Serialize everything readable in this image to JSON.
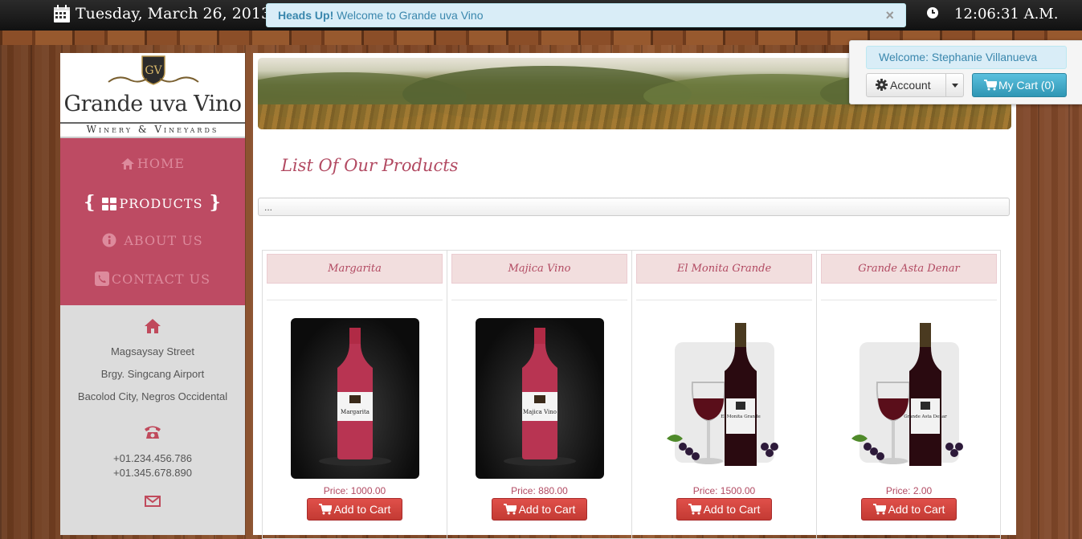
{
  "topbar": {
    "date": "Tuesday, March 26, 2013",
    "time": "12:06:31 A.M.",
    "alert_strong": "Heads Up!",
    "alert_text": "Welcome to Grande uva Vino",
    "alert_close": "×"
  },
  "account": {
    "welcome": "Welcome: Stephanie Villanueva",
    "account_label": "Account",
    "cart_label": "My Cart (0)"
  },
  "brand": {
    "name": "Grande uva Vino",
    "tagline": "Winery & Vineyards",
    "monogram": "GV"
  },
  "nav": {
    "items": [
      {
        "label": "HOME",
        "icon": "home-icon"
      },
      {
        "label": "PRODUCTS",
        "icon": "grid-icon",
        "active": true
      },
      {
        "label": "ABOUT US",
        "icon": "info-icon"
      },
      {
        "label": "CONTACT US",
        "icon": "phone-square-icon"
      }
    ]
  },
  "contact": {
    "address": [
      "Magsaysay Street",
      "Brgy. Singcang Airport",
      "Bacolod City, Negros Occidental"
    ],
    "phones": [
      "+01.234.456.786",
      "+01.345.678.890"
    ]
  },
  "main": {
    "title": "List Of Our Products",
    "breadcrumb": "..."
  },
  "products": [
    {
      "name": "Margarita",
      "price": "Price: 1000.00",
      "button": "Add to Cart",
      "label_text": "Margarita"
    },
    {
      "name": "Majica Vino",
      "price": "Price: 880.00",
      "button": "Add to Cart",
      "label_text": "Majica Vino"
    },
    {
      "name": "El Monita Grande",
      "price": "Price: 1500.00",
      "button": "Add to Cart",
      "label_text": "El Monita Grande"
    },
    {
      "name": "Grande Asta Denar",
      "price": "Price: 2.00",
      "button": "Add to Cart",
      "label_text": "Grande Asta Denar"
    }
  ],
  "colors": {
    "accent": "#bd4b63",
    "title": "#b24a62",
    "cart_button": "#c33a33",
    "info": "#3a87ad"
  }
}
